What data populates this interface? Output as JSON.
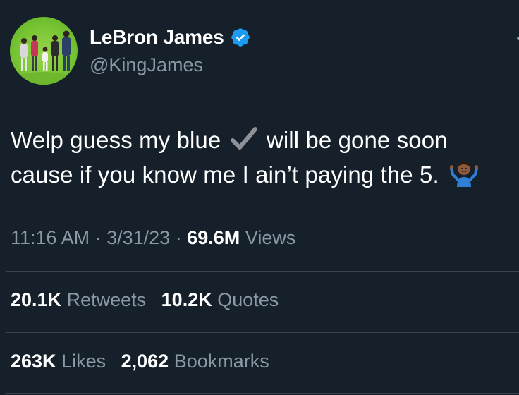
{
  "user": {
    "display_name": "LeBron James",
    "handle": "@KingJames",
    "verified": true,
    "avatar_icon": "profile-photo",
    "verified_color": "#1d9bf0"
  },
  "tweet": {
    "text_part1": "Welp guess my blue",
    "text_part2": "will be gone soon cause if you know me I ain’t paying the 5.",
    "emoji_check": "check-mark-emoji",
    "emoji_shrug": "person-shrugging-emoji"
  },
  "meta": {
    "time": "11:16 AM",
    "separator": "·",
    "date": "3/31/23",
    "views_count": "69.6M",
    "views_label": "Views"
  },
  "stats": {
    "retweets_count": "20.1K",
    "retweets_label": "Retweets",
    "quotes_count": "10.2K",
    "quotes_label": "Quotes",
    "likes_count": "263K",
    "likes_label": "Likes",
    "bookmarks_count": "2,062",
    "bookmarks_label": "Bookmarks"
  },
  "colors": {
    "background": "#15202b",
    "primary_text": "#ffffff",
    "secondary_text": "#8b98a5",
    "divider": "#38444d"
  }
}
